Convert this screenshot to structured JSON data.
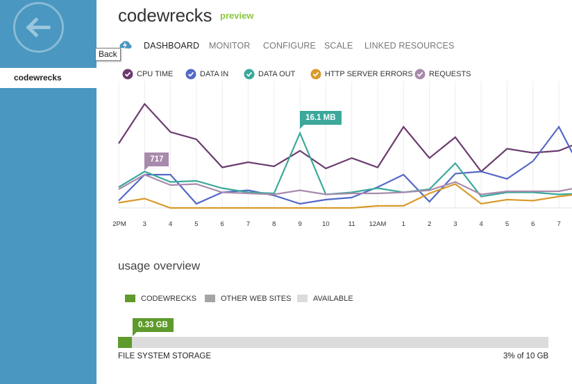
{
  "app": {
    "site_name": "codewrecks",
    "badge": "preview",
    "back_tooltip": "Back"
  },
  "sidebar": {
    "items": [
      {
        "label": "codewrecks",
        "selected": true
      }
    ]
  },
  "tabs": [
    {
      "label": "DASHBOARD",
      "active": true
    },
    {
      "label": "MONITOR",
      "active": false
    },
    {
      "label": "CONFIGURE",
      "active": false
    },
    {
      "label": "SCALE",
      "active": false
    },
    {
      "label": "LINKED RESOURCES",
      "active": false
    }
  ],
  "chart_data": {
    "type": "line",
    "legend": [
      {
        "name": "CPU TIME",
        "color": "#6b3b6e",
        "checked": true
      },
      {
        "name": "DATA IN",
        "color": "#5468c6",
        "checked": true
      },
      {
        "name": "DATA OUT",
        "color": "#3ba89a",
        "checked": true
      },
      {
        "name": "HTTP SERVER ERRORS",
        "color": "#d99a2b",
        "checked": true
      },
      {
        "name": "REQUESTS",
        "color": "#a88aac",
        "checked": true
      }
    ],
    "x_tick_labels": [
      "2PM",
      "3",
      "4",
      "5",
      "6",
      "7",
      "8",
      "9",
      "10",
      "11",
      "12AM",
      "1",
      "2",
      "3",
      "4",
      "5",
      "6",
      "7"
    ],
    "series": [
      {
        "name": "CPU TIME",
        "color": "#6b3b6e",
        "values": [
          62,
          100,
          73,
          66,
          39,
          44,
          40,
          55,
          38,
          48,
          39,
          78,
          48,
          68,
          35,
          57,
          53,
          55,
          65
        ]
      },
      {
        "name": "DATA IN",
        "color": "#5468c6",
        "values": [
          7,
          32,
          32,
          4,
          15,
          17,
          12,
          4,
          8,
          10,
          20,
          32,
          6,
          33,
          35,
          28,
          45,
          78,
          30
        ]
      },
      {
        "name": "DATA OUT",
        "color": "#3ba89a",
        "values": [
          20,
          35,
          25,
          26,
          19,
          15,
          14,
          72,
          13,
          15,
          19,
          15,
          18,
          43,
          11,
          15,
          15,
          13,
          14
        ]
      },
      {
        "name": "HTTP SERVER ERRORS",
        "color": "#d99a2b",
        "values": [
          5,
          9,
          0,
          0,
          0,
          0,
          0,
          0,
          0,
          0,
          2,
          2,
          14,
          23,
          4,
          8,
          7,
          11,
          14
        ]
      },
      {
        "name": "REQUESTS",
        "color": "#a88aac",
        "values": [
          18,
          32,
          22,
          23,
          15,
          14,
          13,
          17,
          13,
          14,
          14,
          15,
          17,
          25,
          13,
          16,
          16,
          16,
          21
        ]
      }
    ],
    "callouts": [
      {
        "series": "REQUESTS",
        "label": "717",
        "color": "#a88aac"
      },
      {
        "series": "DATA OUT",
        "label": "16.1 MB",
        "color": "#3ba89a"
      }
    ]
  },
  "usage": {
    "title": "usage overview",
    "legend": [
      {
        "label": "CODEWRECKS",
        "color": "#5e9a2c"
      },
      {
        "label": "OTHER WEB SITES",
        "color": "#a5a5a5"
      },
      {
        "label": "AVAILABLE",
        "color": "#dcdcdc"
      }
    ],
    "storage": {
      "value_label": "0.33 GB",
      "name": "FILE SYSTEM STORAGE",
      "usage_text": "3% of 10 GB",
      "used_fraction": 0.033
    }
  }
}
